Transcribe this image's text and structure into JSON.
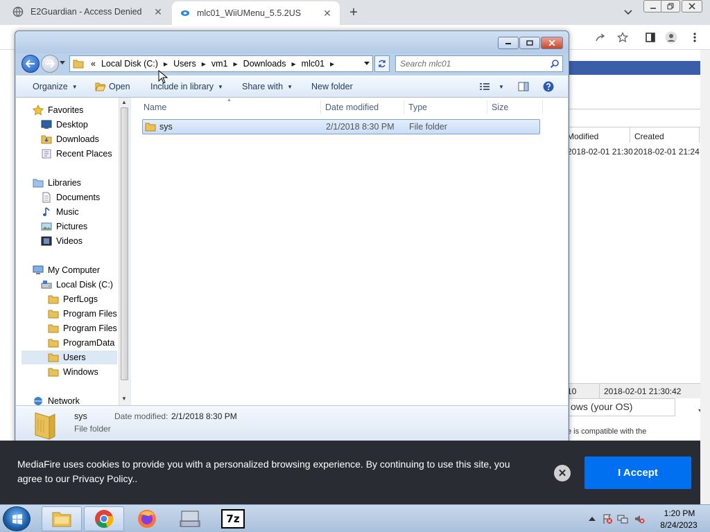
{
  "browser": {
    "tabs": [
      {
        "title": "E2Guardian - Access Denied",
        "icon": "globe-icon"
      },
      {
        "title": "mlc01_WiiUMenu_5.5.2US",
        "icon": "mediafire-icon"
      }
    ],
    "new_tab": "+",
    "tab_close": "✕"
  },
  "explorer": {
    "breadcrumb": [
      "Local Disk (C:)",
      "Users",
      "vm1",
      "Downloads",
      "mlc01"
    ],
    "breadcrumb_prefix": "«",
    "search_placeholder": "Search mlc01",
    "commands": {
      "organize": "Organize",
      "open": "Open",
      "include": "Include in library",
      "share": "Share with",
      "new_folder": "New folder"
    },
    "nav": {
      "favorites": "Favorites",
      "desktop": "Desktop",
      "downloads": "Downloads",
      "recent": "Recent Places",
      "libraries": "Libraries",
      "documents": "Documents",
      "music": "Music",
      "pictures": "Pictures",
      "videos": "Videos",
      "computer": "My Computer",
      "localdisk": "Local Disk (C:)",
      "perflogs": "PerfLogs",
      "programfiles": "Program Files",
      "programfilesx86": "Program Files (",
      "programdata": "ProgramData",
      "users": "Users",
      "windows": "Windows",
      "network": "Network"
    },
    "columns": {
      "name": "Name",
      "date": "Date modified",
      "type": "Type",
      "size": "Size"
    },
    "files": [
      {
        "name": "sys",
        "date": "2/1/2018 8:30 PM",
        "type": "File folder",
        "size": ""
      }
    ],
    "details": {
      "name": "sys",
      "type": "File folder",
      "date_label": "Date modified:",
      "date_value": "2/1/2018 8:30 PM"
    }
  },
  "background_page": {
    "col_modified": "Modified",
    "col_created": "Created",
    "col_a": "Ac",
    "row_modified": "2018-02-01 21:30",
    "row_created": "2018-02-01 21:24",
    "row_a": "20",
    "bottom_left": "10",
    "bottom_date": "2018-02-01 21:30:42",
    "os_select": "ows (your OS)",
    "note": "e is compatible with the"
  },
  "cookie": {
    "text": "MediaFire uses cookies to provide you with a personalized browsing experience. By continuing to use this site, you agree to our Privacy Policy..",
    "close": "✕",
    "accept": "I Accept"
  },
  "taskbar": {
    "time": "1:20 PM",
    "date": "8/24/2023",
    "apps": [
      "explorer-icon",
      "chrome-icon",
      "firefox-icon",
      "keyboard-icon",
      "7zip-icon"
    ],
    "sevenzip_label": "7z"
  },
  "colors": {
    "accept_button": "#0070f0",
    "cookie_bg": "#2a2c33",
    "selection": "#c9ddf6"
  }
}
